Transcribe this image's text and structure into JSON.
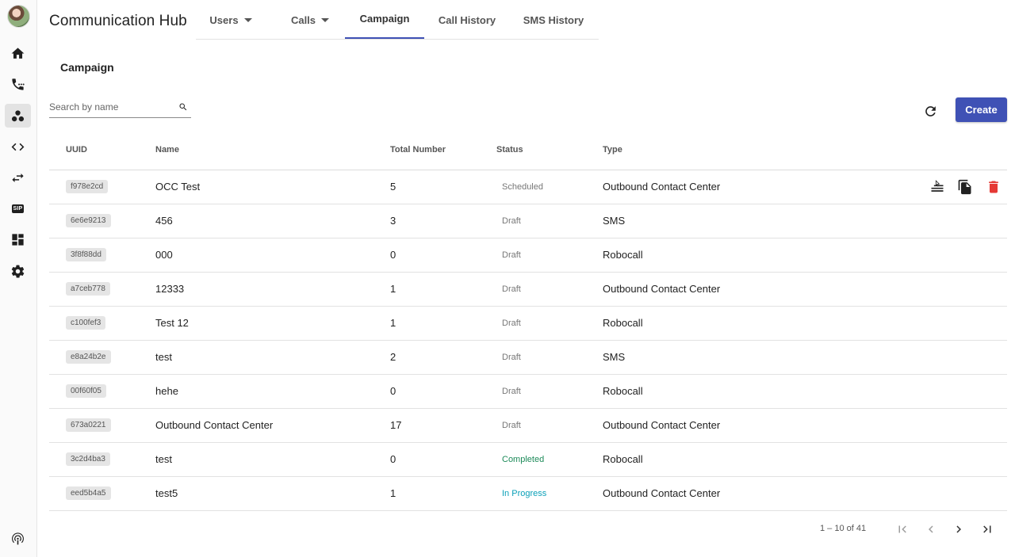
{
  "app": {
    "title": "Communication Hub"
  },
  "sidebar": {
    "items": [
      {
        "icon": "home-icon"
      },
      {
        "icon": "phone-dialpad-icon"
      },
      {
        "icon": "campaign-group-icon"
      },
      {
        "icon": "code-icon"
      },
      {
        "icon": "swap-arrows-icon"
      },
      {
        "icon": "sip-icon",
        "label": "SIP"
      },
      {
        "icon": "dashboard-icon"
      },
      {
        "icon": "gear-icon"
      },
      {
        "icon": "podcast-signal-icon"
      }
    ]
  },
  "tabs": [
    {
      "label": "Users",
      "dropdown": true
    },
    {
      "label": "Calls",
      "dropdown": true
    },
    {
      "label": "Campaign",
      "active": true
    },
    {
      "label": "Call History"
    },
    {
      "label": "SMS History"
    }
  ],
  "section": {
    "title": "Campaign"
  },
  "search": {
    "placeholder": "Search by name",
    "value": ""
  },
  "toolbar": {
    "create_label": "Create"
  },
  "table": {
    "headers": [
      "UUID",
      "Name",
      "Total Number",
      "Status",
      "Type"
    ],
    "rows": [
      {
        "uuid": "f978e2cd",
        "name": "OCC Test",
        "total": "5",
        "status": "Scheduled",
        "type": "Outbound Contact Center"
      },
      {
        "uuid": "6e6e9213",
        "name": "456",
        "total": "3",
        "status": "Draft",
        "type": "SMS"
      },
      {
        "uuid": "3f8f88dd",
        "name": "000",
        "total": "0",
        "status": "Draft",
        "type": "Robocall"
      },
      {
        "uuid": "a7ceb778",
        "name": "12333",
        "total": "1",
        "status": "Draft",
        "type": "Outbound Contact Center"
      },
      {
        "uuid": "c100fef3",
        "name": "Test 12",
        "total": "1",
        "status": "Draft",
        "type": "Robocall"
      },
      {
        "uuid": "e8a24b2e",
        "name": "test",
        "total": "2",
        "status": "Draft",
        "type": "SMS"
      },
      {
        "uuid": "00f60f05",
        "name": "hehe",
        "total": "0",
        "status": "Draft",
        "type": "Robocall"
      },
      {
        "uuid": "673a0221",
        "name": "Outbound Contact Center",
        "total": "17",
        "status": "Draft",
        "type": "Outbound Contact Center"
      },
      {
        "uuid": "3c2d4ba3",
        "name": "test",
        "total": "0",
        "status": "Completed",
        "type": "Robocall"
      },
      {
        "uuid": "eed5b4a5",
        "name": "test5",
        "total": "1",
        "status": "In Progress",
        "type": "Outbound Contact Center"
      }
    ]
  },
  "pagination": {
    "range": "1 – 10 of 41"
  },
  "colors": {
    "accent": "#3f51b5",
    "completed": "#1e8b5a",
    "in_progress": "#0aa0b8",
    "delete": "#e53935"
  }
}
